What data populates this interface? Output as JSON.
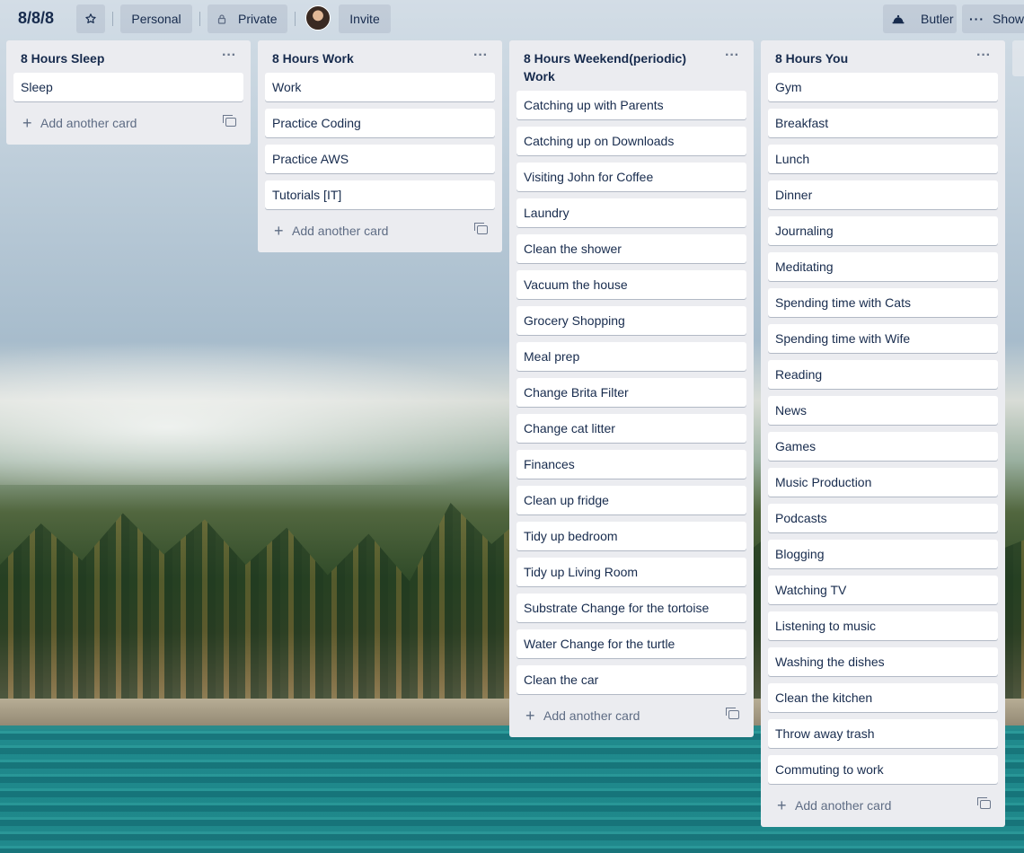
{
  "board": {
    "title": "8/8/8",
    "personal_label": "Personal",
    "private_label": "Private",
    "invite_label": "Invite",
    "butler_label": "Butler",
    "show_label": "Show"
  },
  "add_card_label": "Add another card",
  "lists": [
    {
      "title": "8 Hours Sleep",
      "cards": [
        "Sleep"
      ]
    },
    {
      "title": "8 Hours Work",
      "cards": [
        "Work",
        "Practice Coding",
        "Practice AWS",
        "Tutorials [IT]"
      ]
    },
    {
      "title": "8 Hours Weekend(periodic) Work",
      "cards": [
        "Catching up with Parents",
        "Catching up on Downloads",
        "Visiting John for Coffee",
        "Laundry",
        "Clean the shower",
        "Vacuum the house",
        "Grocery Shopping",
        "Meal prep",
        "Change Brita Filter",
        "Change cat litter",
        "Finances",
        "Clean up fridge",
        "Tidy up bedroom",
        "Tidy up Living Room",
        "Substrate Change for the tortoise",
        "Water Change for the turtle",
        "Clean the car"
      ]
    },
    {
      "title": "8 Hours You",
      "cards": [
        "Gym",
        "Breakfast",
        "Lunch",
        "Dinner",
        "Journaling",
        "Meditating",
        "Spending time with Cats",
        "Spending time with Wife",
        "Reading",
        "News",
        "Games",
        "Music Production",
        "Podcasts",
        "Blogging",
        "Watching TV",
        "Listening to music",
        "Washing the dishes",
        "Clean the kitchen",
        "Throw away trash",
        "Commuting to work"
      ]
    }
  ],
  "icons": {
    "star": "star-icon",
    "lock": "lock-icon",
    "butler": "butler-icon",
    "more": "more-icon",
    "plus": "plus-icon",
    "template": "card-template-icon"
  },
  "colors": {
    "list_bg": "#ebecf0",
    "card_bg": "#ffffff",
    "text": "#172b4d",
    "muted": "#5e6c84"
  }
}
